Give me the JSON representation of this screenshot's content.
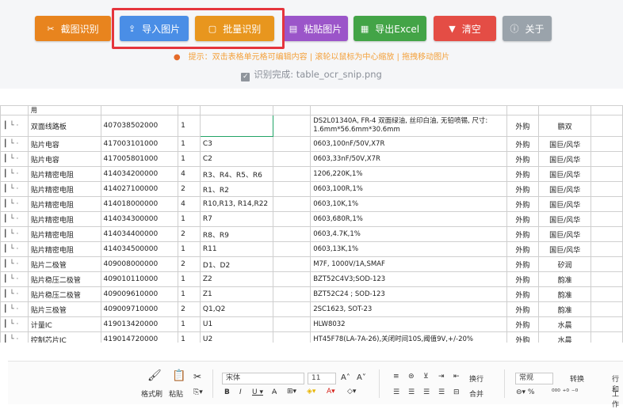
{
  "toolbar": {
    "buttons": [
      {
        "label": "截图识别",
        "icon": "scissors-icon",
        "glyph": "✂",
        "color": "#e8841e"
      },
      {
        "label": "导入图片",
        "icon": "upload-image-icon",
        "glyph": "⇪",
        "color": "#4a8ee6"
      },
      {
        "label": "批量识别",
        "icon": "batch-icon",
        "glyph": "▢",
        "color": "#e8961e"
      },
      {
        "label": "粘贴图片",
        "icon": "paste-icon",
        "glyph": "▤",
        "color": "#9b55c9"
      },
      {
        "label": "导出Excel",
        "icon": "excel-icon",
        "glyph": "▦",
        "color": "#43a447"
      },
      {
        "label": "清空",
        "icon": "trash-icon",
        "glyph": "▼",
        "color": "#e44d45"
      },
      {
        "label": "关于",
        "icon": "info-icon",
        "glyph": "ⓘ",
        "color": "#9aa3ab"
      }
    ]
  },
  "tip": "提示：双击表格单元格可编辑内容 | 滚轮以鼠标为中心缩放 | 拖拽移动图片",
  "status": "识别完成: table_ocr_snip.png",
  "table": {
    "header_fragment": "用",
    "rows": [
      {
        "lvl": "┃ └ ·",
        "name": "双面线路板",
        "code": "407038502000",
        "qty": "1",
        "ref": "",
        "spec": "DS2L01340A, FR-4 双面绿油, 丝印白油, 无铅喷锡, 尺寸: 1.6mm*56.6mm*30.6mm",
        "src": "外购",
        "vendor": "鹏双",
        "tall": true
      },
      {
        "lvl": "┃ └ ·",
        "name": "贴片电容",
        "code": "417003101000",
        "qty": "1",
        "ref": "C3",
        "spec": "0603,100nF/50V,X7R",
        "src": "外购",
        "vendor": "国巨/风华"
      },
      {
        "lvl": "┃ └ ·",
        "name": "贴片电容",
        "code": "417005801000",
        "qty": "1",
        "ref": "C2",
        "spec": "0603,33nF/50V,X7R",
        "src": "外购",
        "vendor": "国巨/风华"
      },
      {
        "lvl": "┃ └ ·",
        "name": "贴片精密电阻",
        "code": "414034200000",
        "qty": "4",
        "ref": "R3、R4、R5、R6",
        "spec": "1206,220K,1%",
        "src": "外购",
        "vendor": "国巨/风华"
      },
      {
        "lvl": "┃ └ ·",
        "name": "贴片精密电阻",
        "code": "414027100000",
        "qty": "2",
        "ref": "R1、R2",
        "spec": "0603,100R,1%",
        "src": "外购",
        "vendor": "国巨/风华"
      },
      {
        "lvl": "┃ └ ·",
        "name": "贴片精密电阻",
        "code": "414018000000",
        "qty": "4",
        "ref": "R10,R13, R14,R22",
        "spec": "0603,10K,1%",
        "src": "外购",
        "vendor": "国巨/风华"
      },
      {
        "lvl": "┃ └ ·",
        "name": "贴片精密电阻",
        "code": "414034300000",
        "qty": "1",
        "ref": "R7",
        "spec": "0603,680R,1%",
        "src": "外购",
        "vendor": "国巨/风华"
      },
      {
        "lvl": "┃ └ ·",
        "name": "贴片精密电阻",
        "code": "414034400000",
        "qty": "2",
        "ref": "R8、R9",
        "spec": "0603,4.7K,1%",
        "src": "外购",
        "vendor": "国巨/风华"
      },
      {
        "lvl": "┃ └ ·",
        "name": "贴片精密电阻",
        "code": "414034500000",
        "qty": "1",
        "ref": "R11",
        "spec": "0603,13K,1%",
        "src": "外购",
        "vendor": "国巨/风华"
      },
      {
        "lvl": "┃ └ ·",
        "name": "贴片二极管",
        "code": "409008000000",
        "qty": "2",
        "ref": "D1、D2",
        "spec": "M7F, 1000V/1A,SMAF",
        "src": "外购",
        "vendor": "矽润"
      },
      {
        "lvl": "┃ └ ·",
        "name": "贴片稳压二极管",
        "code": "409010110000",
        "qty": "1",
        "ref": "Z2",
        "spec": "BZT52C4V3;SOD-123",
        "src": "外购",
        "vendor": "韵准"
      },
      {
        "lvl": "┃ └ ·",
        "name": "贴片稳压二极管",
        "code": "409009610000",
        "qty": "1",
        "ref": "Z1",
        "spec": "BZT52C24 ; SOD-123",
        "src": "外购",
        "vendor": "韵准"
      },
      {
        "lvl": "┃ └ ·",
        "name": "贴片三极管",
        "code": "409009710000",
        "qty": "2",
        "ref": "Q1,Q2",
        "spec": "2SC1623, SOT-23",
        "src": "外购",
        "vendor": "韵准"
      },
      {
        "lvl": "┃ └ ·",
        "name": "计量IC",
        "code": "419013420000",
        "qty": "1",
        "ref": "U1",
        "spec": "HLW8032",
        "src": "外购",
        "vendor": "水晨"
      },
      {
        "lvl": "┃ └ ·",
        "name": "控制芯片IC",
        "code": "419014720000",
        "qty": "1",
        "ref": "U2",
        "spec": "HT45F78(LA-7A-26),关闭时间10S,阈值9V,+/-20%",
        "src": "外购",
        "vendor": "水晨"
      }
    ]
  },
  "ribbon": {
    "format_painter": "格式刷",
    "paste": "粘贴",
    "font_name": "宋体",
    "font_size": "11",
    "wrap": "换行",
    "merge": "合并",
    "number_format": "常规",
    "convert": "转换",
    "rows_cols": "行和",
    "sheet": "工作"
  }
}
